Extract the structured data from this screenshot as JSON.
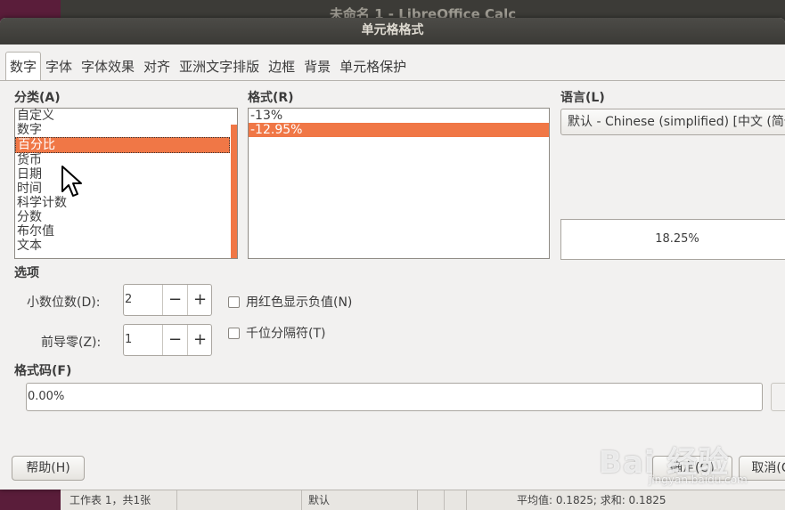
{
  "background": {
    "window_title": "未命名 1 - LibreOffice Calc",
    "status_sheet": "工作表 1，共1张",
    "status_lang": "默认",
    "status_sum": "平均值: 0.1825; 求和: 0.1825"
  },
  "dialog": {
    "title": "单元格格式",
    "tabs": [
      "数字",
      "字体",
      "字体效果",
      "对齐",
      "亚洲文字排版",
      "边框",
      "背景",
      "单元格保护"
    ],
    "active_tab": "数字",
    "category": {
      "label": "分类(A)",
      "items": [
        "自定义",
        "数字",
        "百分比",
        "货币",
        "日期",
        "时间",
        "科学计数",
        "分数",
        "布尔值",
        "文本"
      ],
      "selected": "百分比"
    },
    "format": {
      "label": "格式(R)",
      "items": [
        "-13%",
        "-12.95%"
      ],
      "selected": "-12.95%"
    },
    "language": {
      "label": "语言(L)",
      "value": "默认 - Chinese (simplified) [中文 (简体"
    },
    "preview": "18.25%",
    "options": {
      "label": "选项",
      "decimal_label": "小数位数(D):",
      "decimal_value": "2",
      "leading_label": "前导零(Z):",
      "leading_value": "1",
      "negative_red_label": "用红色显示负值(N)",
      "thousands_label": "千位分隔符(T)",
      "minus": "−",
      "plus": "+"
    },
    "format_code": {
      "label": "格式码(F)",
      "value": "0.00%"
    },
    "buttons": {
      "help": "帮助(H)",
      "ok": "确定(O)",
      "cancel": "取消(C"
    }
  },
  "watermark": {
    "text": "Bai 经验",
    "sub": "jingyan.baidu.com"
  },
  "colors": {
    "selection": "#f07746",
    "titlebar": "#3b3a36",
    "dialog_bg": "#f2f1f0"
  }
}
